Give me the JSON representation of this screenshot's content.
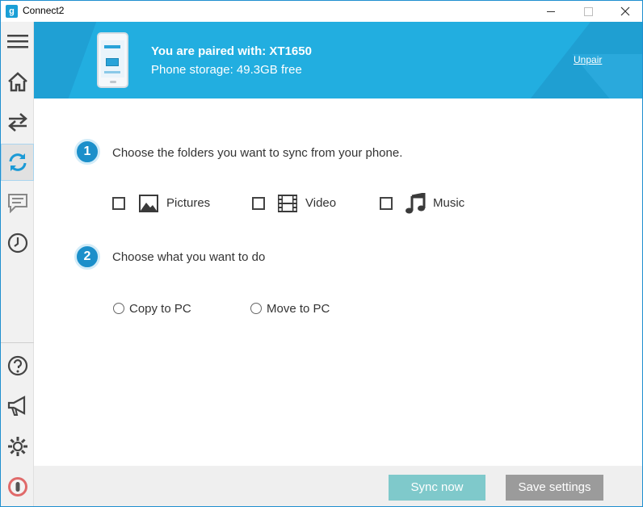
{
  "window": {
    "title": "Connect2",
    "app_icon_glyph": "g"
  },
  "sidebar": {
    "items": [
      {
        "icon": "hamburger-menu-icon"
      },
      {
        "icon": "home-icon"
      },
      {
        "icon": "transfer-arrows-icon"
      },
      {
        "icon": "sync-icon",
        "active": true
      },
      {
        "icon": "chat-icon"
      },
      {
        "icon": "clock-icon"
      },
      {
        "icon": "help-icon"
      },
      {
        "icon": "megaphone-icon"
      },
      {
        "icon": "settings-gear-icon"
      },
      {
        "icon": "power-icon"
      }
    ]
  },
  "banner": {
    "title": "You are paired with: XT1650",
    "storage": "Phone storage: 49.3GB free",
    "unpair_label": "Unpair",
    "color": "#22aee0"
  },
  "step1": {
    "number": "1",
    "text": "Choose the folders you want to sync from your phone.",
    "options": [
      {
        "label": "Pictures",
        "icon": "pictures-icon",
        "checked": false
      },
      {
        "label": "Video",
        "icon": "video-film-icon",
        "checked": false
      },
      {
        "label": "Music",
        "icon": "music-note-icon",
        "checked": false
      }
    ]
  },
  "step2": {
    "number": "2",
    "text": "Choose what you want to do",
    "options": [
      {
        "label": "Copy to PC",
        "selected": false
      },
      {
        "label": "Move to PC",
        "selected": false
      }
    ]
  },
  "footer": {
    "sync_label": "Sync now",
    "save_label": "Save settings",
    "sync_color": "#7fc9cb",
    "save_color": "#9b9b9b"
  }
}
